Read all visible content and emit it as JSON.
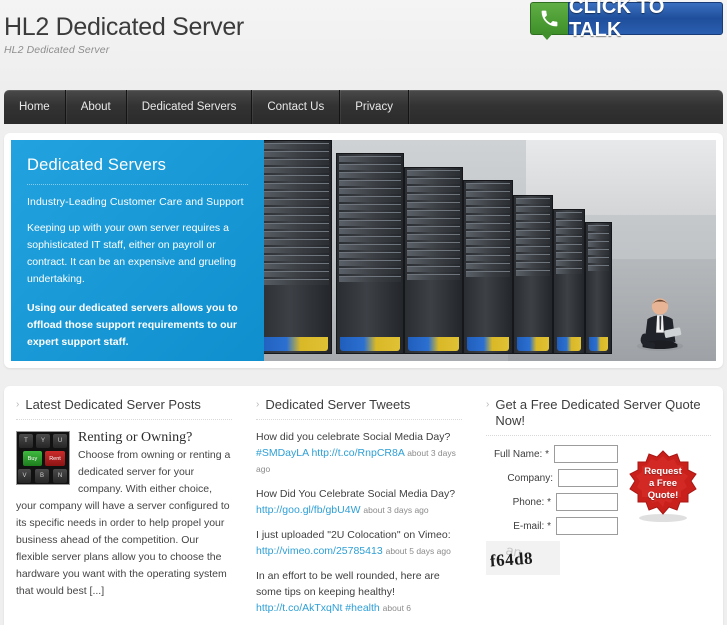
{
  "header": {
    "site_title": "HL2 Dedicated Server",
    "tagline": "HL2 Dedicated Server",
    "click_to_talk": {
      "label": "CLICK TO TALK",
      "phone_icon": "phone-icon",
      "icon_color": "#4d9e36",
      "button_color": "#26539f"
    }
  },
  "nav": {
    "items": [
      {
        "label": "Home"
      },
      {
        "label": "About"
      },
      {
        "label": "Dedicated Servers"
      },
      {
        "label": "Contact Us"
      },
      {
        "label": "Privacy"
      }
    ]
  },
  "hero": {
    "panel_color": "#1799d6",
    "title": "Dedicated Servers",
    "subtitle": "Industry-Leading Customer Care and Support",
    "body": "Keeping up with your own server requires a sophisticated IT staff, either on payroll or contract. It can be an expensive and grueling undertaking.",
    "highlight": "Using our dedicated servers allows you to offload those support requirements to our expert support staff.",
    "image_alt": "server-room-racks-with-man-on-laptop"
  },
  "posts_widget": {
    "arrow": "›",
    "title": "Latest Dedicated Server Posts",
    "post": {
      "thumb_alt": "keyboard-buy-rent-keys",
      "thumb_keys": [
        "T",
        "Y",
        "U",
        "Buy",
        "Rent",
        "V",
        "B",
        "N"
      ],
      "title": "Renting or Owning?",
      "excerpt": "Choose from owning or renting a dedicated server for your company. With either choice, your company will have a server configured to its specific needs in order to help propel your business ahead of the competition. Our flexible server plans allow you to choose the hardware you want with the operating system that would best [...]"
    }
  },
  "tweets_widget": {
    "arrow": "›",
    "title": "Dedicated Server Tweets",
    "tweets": [
      {
        "text": "How did you celebrate Social Media Day? ",
        "hashtag": "#SMDayLA",
        "link": "http://t.co/RnpCR8A",
        "ago": "about 3 days ago"
      },
      {
        "text": "How Did You Celebrate Social Media Day? ",
        "hashtag": "",
        "link": "http://goo.gl/fb/gbU4W",
        "ago": "about 3 days ago"
      },
      {
        "text": "I just uploaded \"2U Colocation\" on Vimeo: ",
        "hashtag": "",
        "link": "http://vimeo.com/25785413",
        "ago": "about 5 days ago"
      },
      {
        "text": "In an effort to be well rounded, here are some tips on keeping healthy! ",
        "hashtag": "#health",
        "link": "http://t.co/AkTxqNt",
        "ago": "about 6"
      }
    ]
  },
  "quote_widget": {
    "arrow": "›",
    "title": "Get a Free Dedicated Server Quote Now!",
    "fields": [
      {
        "label": "Full Name:",
        "required": "*",
        "value": "",
        "placeholder": ""
      },
      {
        "label": "Company:",
        "required": "",
        "value": "",
        "placeholder": ""
      },
      {
        "label": "Phone:",
        "required": "*",
        "value": "",
        "placeholder": ""
      },
      {
        "label": "E-mail:",
        "required": "*",
        "value": "",
        "placeholder": ""
      }
    ],
    "captcha_text": "f64d8",
    "captcha_noise": "an",
    "badge": {
      "line1": "Request",
      "line2": "a Free",
      "line3": "Quote!",
      "color": "#c9201c"
    }
  }
}
